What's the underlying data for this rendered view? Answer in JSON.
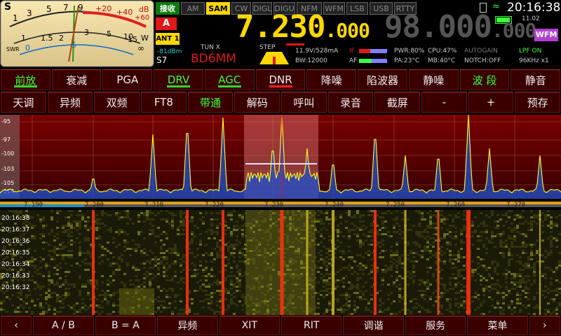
{
  "meter": {
    "s_label": "S",
    "s_scale": [
      "1",
      "3",
      "5",
      "7",
      "9",
      "+20",
      "+40",
      "+60"
    ],
    "db_label": "dB",
    "swr_scale": [
      "1",
      "1.5",
      "2",
      "3",
      "5",
      "10",
      "15",
      "∞"
    ],
    "swr_label": "SWR",
    "w_label": "W",
    "power_scale": [
      "0",
      "5"
    ],
    "dbm": "-81dBm",
    "s_reading": "S7"
  },
  "status": {
    "rx_label": "接收",
    "antenna_letter": "A",
    "antenna_label": "ANT 1",
    "callsign": "BD6MM",
    "tune_label": "TUN X",
    "step_label": "STEP",
    "main_freq": "7.230.000",
    "main_freq_big": "7.230",
    "main_freq_small": ".000",
    "sub_freq_big": "98.000",
    "sub_freq_small": ".000",
    "sub_mode": "WFM",
    "clock": "20:16:38",
    "battery_voltage": "11.02",
    "supply": "11.9V/528mA",
    "bandwidth": "BW:12000",
    "if_label": "IF",
    "af_label": "AF",
    "pwr": "PWR:80%",
    "cpu": "CPU:47%",
    "autogain": "AUTOGAIN",
    "pa": "PA:23°C",
    "mb": "MB:40°C",
    "notch": "NOTCH:OFF",
    "lpf": "LPF ON",
    "sample": "96KHz x1"
  },
  "modes": [
    {
      "label": "AM",
      "state": "off"
    },
    {
      "label": "SAM",
      "state": "active"
    },
    {
      "label": "CW",
      "state": "off"
    },
    {
      "label": "DIGL",
      "state": "off"
    },
    {
      "label": "DIGU",
      "state": "off"
    },
    {
      "label": "NFM",
      "state": "off"
    },
    {
      "label": "WFM",
      "state": "off"
    },
    {
      "label": "LSB",
      "state": "off"
    },
    {
      "label": "USB",
      "state": "off"
    },
    {
      "label": "RTTY",
      "state": "off"
    }
  ],
  "fn_row1": [
    {
      "label": "前放",
      "color": "#3dff3d",
      "underline": "#2fd82f"
    },
    {
      "label": "衰减",
      "color": "#eeeeee",
      "underline": ""
    },
    {
      "label": "PGA",
      "color": "#eeeeee",
      "underline": ""
    },
    {
      "label": "DRV",
      "color": "#3dff3d",
      "underline": "#2fd82f"
    },
    {
      "label": "AGC",
      "color": "#3dff3d",
      "underline": "#2fd82f"
    },
    {
      "label": "DNR",
      "color": "#eeeeee",
      "underline": "#ff2222"
    },
    {
      "label": "降噪",
      "color": "#eeeeee",
      "underline": ""
    },
    {
      "label": "陷波器",
      "color": "#eeeeee",
      "underline": ""
    },
    {
      "label": "静噪",
      "color": "#eeeeee",
      "underline": ""
    },
    {
      "label": "波 段",
      "color": "#3dff3d",
      "underline": ""
    },
    {
      "label": "静音",
      "color": "#eeeeee",
      "underline": ""
    }
  ],
  "fn_row2": [
    {
      "label": "天调",
      "color": "#eeeeee"
    },
    {
      "label": "异频",
      "color": "#eeeeee"
    },
    {
      "label": "双频",
      "color": "#eeeeee"
    },
    {
      "label": "FT8",
      "color": "#eeeeee"
    },
    {
      "label": "带通",
      "color": "#3dff3d"
    },
    {
      "label": "解码",
      "color": "#eeeeee"
    },
    {
      "label": "呼叫",
      "color": "#eeeeee"
    },
    {
      "label": "录音",
      "color": "#eeeeee"
    },
    {
      "label": "截屏",
      "color": "#eeeeee"
    },
    {
      "label": "-",
      "color": "#eeeeee"
    },
    {
      "label": "+",
      "color": "#eeeeee"
    },
    {
      "label": "预存",
      "color": "#eeeeee"
    }
  ],
  "spectrum": {
    "db_ticks": [
      "-95",
      "-97",
      "-100",
      "-103",
      "-105",
      "-114"
    ],
    "freq_ticks": [
      "7.190",
      "7.200",
      "7.210",
      "7.220",
      "7.230",
      "7.240",
      "7.250",
      "7.260",
      "7.270"
    ],
    "center_label": "7.230"
  },
  "waterfall": {
    "times": [
      "20:16:38",
      "20:16:37",
      "20:16:36",
      "20:16:35",
      "20:16:34",
      "20:16:33",
      "20:16:32"
    ]
  },
  "bottom_row": [
    {
      "label": "‹"
    },
    {
      "label": "A / B"
    },
    {
      "label": "B = A"
    },
    {
      "label": "异频"
    },
    {
      "label": "XIT"
    },
    {
      "label": "RIT"
    },
    {
      "label": "调谐"
    },
    {
      "label": "服务"
    },
    {
      "label": "菜单"
    },
    {
      "label": "›"
    }
  ],
  "colors": {
    "accent_yellow": "#ffd800",
    "button_bg": "#3a0000",
    "rx_green": "#0c7a0c",
    "wfm_purple": "#b040d0",
    "spectrum_bg": "#5a0000",
    "signal_yellow": "#ffff20"
  }
}
